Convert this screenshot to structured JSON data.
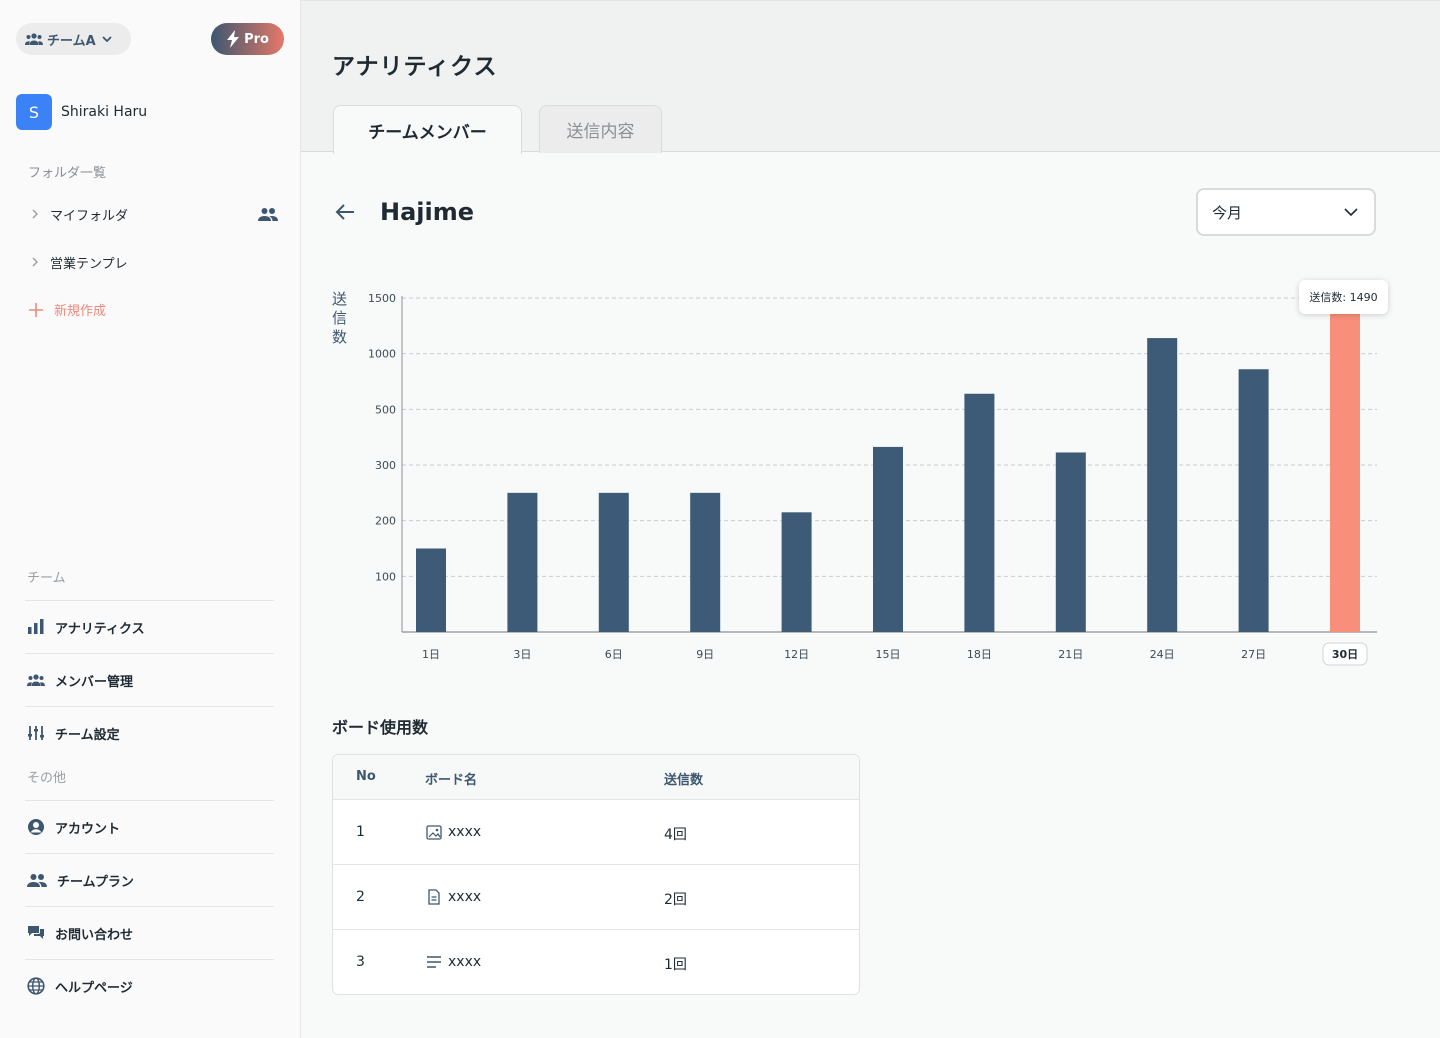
{
  "sidebar": {
    "team_selector": "チームA",
    "pro_label": "Pro",
    "user": {
      "initial": "S",
      "name": "Shiraki Haru"
    },
    "folder_section_label": "フォルダ一覧",
    "folders": [
      {
        "label": "マイフォルダ",
        "icon": "shared-users-icon"
      },
      {
        "label": "営業テンプレ"
      }
    ],
    "new_label": "新規作成",
    "team_section_label": "チーム",
    "team_nav": [
      {
        "label": "アナリティクス",
        "icon": "bar-chart-icon"
      },
      {
        "label": "メンバー管理",
        "icon": "team-icon"
      },
      {
        "label": "チーム設定",
        "icon": "sliders-icon"
      }
    ],
    "other_section_label": "その他",
    "other_nav": [
      {
        "label": "アカウント",
        "icon": "account-circle-icon"
      },
      {
        "label": "チームプラン",
        "icon": "people-icon"
      },
      {
        "label": "お問い合わせ",
        "icon": "chat-icon"
      },
      {
        "label": "ヘルプページ",
        "icon": "globe-icon"
      }
    ]
  },
  "header": {
    "title": "アナリティクス",
    "tabs": [
      {
        "label": "チームメンバー",
        "active": true
      },
      {
        "label": "送信内容",
        "active": false
      }
    ]
  },
  "member": {
    "name": "Hajime",
    "period": "今月"
  },
  "chart_data": {
    "type": "bar",
    "ylabel": "送信数",
    "y_ticks": [
      "1500",
      "1000",
      "500",
      "300",
      "200",
      "100"
    ],
    "categories": [
      "1日",
      "3日",
      "6日",
      "9日",
      "12日",
      "15日",
      "18日",
      "21日",
      "24日",
      "27日",
      "30日"
    ],
    "values": [
      150,
      250,
      250,
      250,
      215,
      365,
      640,
      345,
      1140,
      860,
      1490
    ],
    "highlight_index": 10,
    "tooltip": "送信数: 1490",
    "bar_color": "#3d5a77",
    "highlight_color": "#f88f7a",
    "grid": true
  },
  "table": {
    "title": "ボード使用数",
    "headers": [
      "No",
      "ボード名",
      "送信数"
    ],
    "rows": [
      {
        "no": "1",
        "icon": "image-icon",
        "name": "xxxx",
        "count": "4回"
      },
      {
        "no": "2",
        "icon": "document-icon",
        "name": "xxxx",
        "count": "2回"
      },
      {
        "no": "3",
        "icon": "lines-icon",
        "name": "xxxx",
        "count": "1回"
      }
    ]
  }
}
